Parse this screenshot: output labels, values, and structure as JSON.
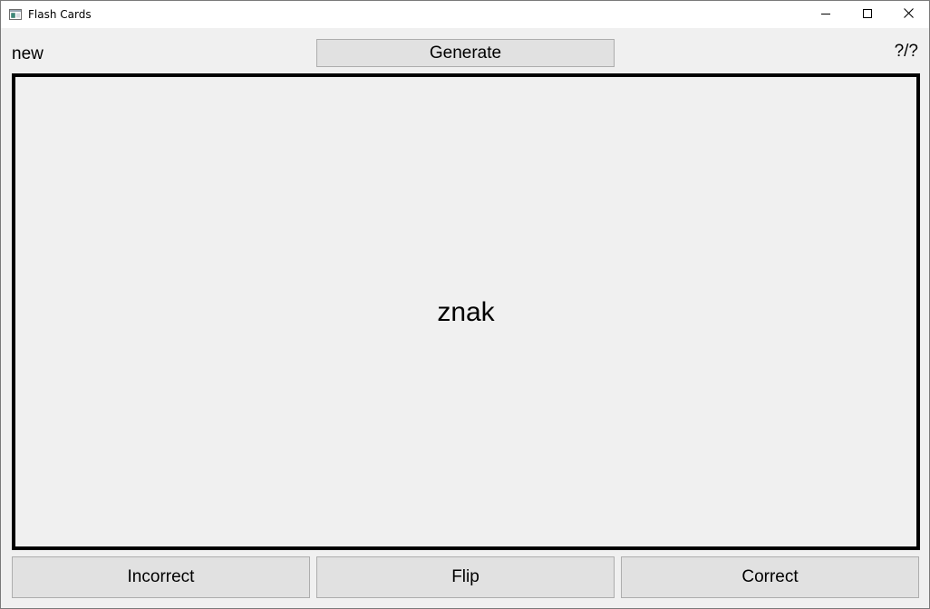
{
  "window": {
    "title": "Flash Cards"
  },
  "icons": {
    "app": "app-window-icon",
    "minimize": "minimize-icon",
    "maximize": "maximize-icon",
    "close": "close-icon"
  },
  "toolbar": {
    "status_label": "new",
    "generate_label": "Generate",
    "counter": "?/?"
  },
  "card": {
    "text": "znak"
  },
  "actions": {
    "incorrect_label": "Incorrect",
    "flip_label": "Flip",
    "correct_label": "Correct"
  },
  "colors": {
    "background": "#f0f0f0",
    "button": "#e1e1e1",
    "button_border": "#adadad",
    "card_border": "#000000"
  }
}
